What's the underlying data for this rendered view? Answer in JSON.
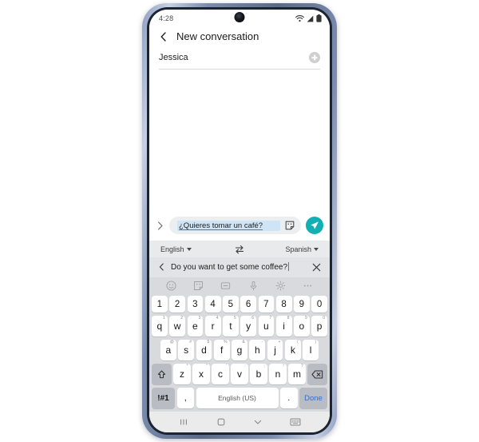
{
  "status_bar": {
    "time": "4:28",
    "icons": [
      "wifi-icon",
      "signal-icon",
      "battery-icon"
    ]
  },
  "app_bar": {
    "back_icon": "chevron-left-icon",
    "title": "New conversation"
  },
  "recipient": {
    "name": "Jessica",
    "add_button_icon": "plus-circle-icon"
  },
  "compose": {
    "expand_icon": "chevron-right-icon",
    "message_text": "¿Quieres tomar un café?",
    "sticker_icon": "sticker-icon",
    "send_icon": "send-paper-plane-icon",
    "send_color": "#12b0b4",
    "highlight_color": "#cfe4f5"
  },
  "translate": {
    "source_language": "English",
    "target_language": "Spanish",
    "swap_icon": "swap-arrows-icon",
    "back_icon": "chevron-left-icon",
    "clear_icon": "close-x-icon",
    "input_text": "Do you want to get some coffee?"
  },
  "keyboard": {
    "toolbar_icons": [
      "emoji-icon",
      "sticker-icon",
      "gif-icon",
      "microphone-icon",
      "settings-gear-icon",
      "more-options-icon"
    ],
    "numbers": [
      "1",
      "2",
      "3",
      "4",
      "5",
      "6",
      "7",
      "8",
      "9",
      "0"
    ],
    "row1": [
      {
        "key": "q",
        "hint": "1"
      },
      {
        "key": "w",
        "hint": "2"
      },
      {
        "key": "e",
        "hint": "3"
      },
      {
        "key": "r",
        "hint": "4"
      },
      {
        "key": "t",
        "hint": "5"
      },
      {
        "key": "y",
        "hint": "6"
      },
      {
        "key": "u",
        "hint": "7"
      },
      {
        "key": "i",
        "hint": "8"
      },
      {
        "key": "o",
        "hint": "9"
      },
      {
        "key": "p",
        "hint": "0"
      }
    ],
    "row2": [
      {
        "key": "a",
        "hint": "@"
      },
      {
        "key": "s",
        "hint": "#"
      },
      {
        "key": "d",
        "hint": "$"
      },
      {
        "key": "f",
        "hint": "%"
      },
      {
        "key": "g",
        "hint": "&"
      },
      {
        "key": "h",
        "hint": "-"
      },
      {
        "key": "j",
        "hint": "+"
      },
      {
        "key": "k",
        "hint": "("
      },
      {
        "key": "l",
        "hint": ")"
      }
    ],
    "row3": [
      {
        "key": "z",
        "hint": "*"
      },
      {
        "key": "x",
        "hint": "\""
      },
      {
        "key": "c",
        "hint": "'"
      },
      {
        "key": "v",
        "hint": ":"
      },
      {
        "key": "b",
        "hint": ";"
      },
      {
        "key": "n",
        "hint": "!"
      },
      {
        "key": "m",
        "hint": "?"
      }
    ],
    "shift_icon": "shift-arrow-icon",
    "backspace_icon": "backspace-icon",
    "symbols_label": "!#1",
    "comma_label": ",",
    "period_label": ".",
    "space_label": "English (US)",
    "done_label": "Done"
  },
  "nav_bar": {
    "recents_icon": "recents-icon",
    "home_icon": "home-square-icon",
    "hide_keyboard_icon": "chevron-down-icon",
    "keyboard_switch_icon": "keyboard-icon"
  }
}
